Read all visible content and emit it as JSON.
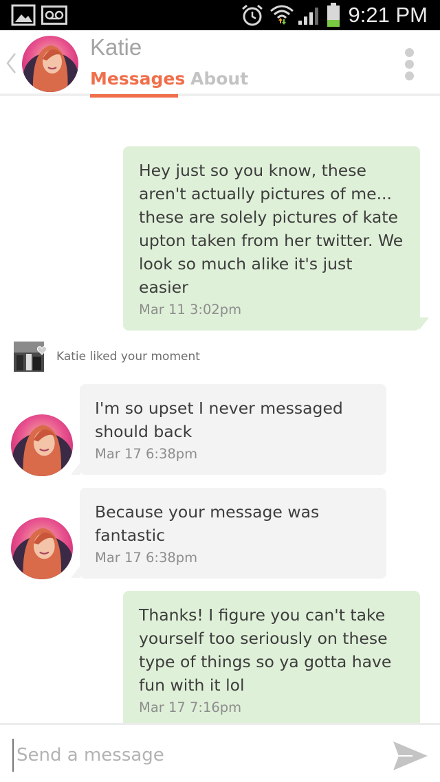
{
  "status_bar": {
    "time": "9:21 PM",
    "icons": [
      "gallery-icon",
      "voicemail-icon",
      "alarm-icon",
      "wifi-icon",
      "signal-icon",
      "battery-icon"
    ]
  },
  "header": {
    "contact_name": "Katie",
    "tabs": [
      {
        "label": "Messages",
        "active": true
      },
      {
        "label": "About",
        "active": false
      }
    ],
    "accent_color": "#ef6f4b"
  },
  "messages": [
    {
      "direction": "outgoing",
      "text": "Hey just so you know, these aren't actually pictures of me... these are solely pictures of kate upton taken from her twitter. We look so much alike it's just easier",
      "time": "Mar 11 3:02pm"
    },
    {
      "direction": "incoming",
      "text": "I'm so upset I never messaged should back",
      "time": "Mar 17 6:38pm"
    },
    {
      "direction": "incoming",
      "text": "Because your message was fantastic",
      "time": "Mar 17 6:38pm"
    },
    {
      "direction": "outgoing",
      "text": "Thanks! I figure you can't take yourself too seriously on these type of things so ya gotta have fun with it lol",
      "time": "Mar 17 7:16pm"
    }
  ],
  "moment_notice": {
    "text": "Katie liked your moment"
  },
  "composer": {
    "placeholder": "Send a message",
    "value": ""
  },
  "colors": {
    "outgoing_bubble": "#dff0d8",
    "incoming_bubble": "#f3f3f3"
  }
}
